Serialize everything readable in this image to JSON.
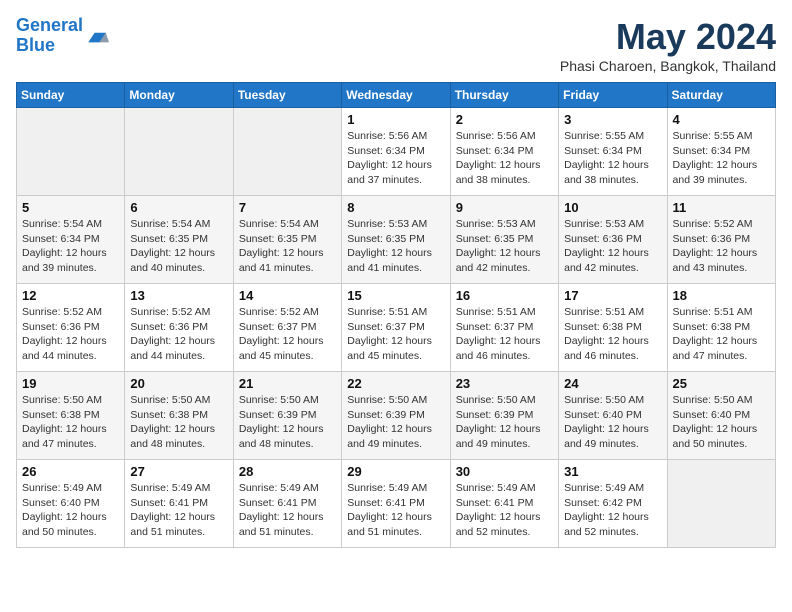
{
  "header": {
    "logo_line1": "General",
    "logo_line2": "Blue",
    "month": "May 2024",
    "location": "Phasi Charoen, Bangkok, Thailand"
  },
  "weekdays": [
    "Sunday",
    "Monday",
    "Tuesday",
    "Wednesday",
    "Thursday",
    "Friday",
    "Saturday"
  ],
  "weeks": [
    [
      {
        "day": "",
        "info": ""
      },
      {
        "day": "",
        "info": ""
      },
      {
        "day": "",
        "info": ""
      },
      {
        "day": "1",
        "info": "Sunrise: 5:56 AM\nSunset: 6:34 PM\nDaylight: 12 hours\nand 37 minutes."
      },
      {
        "day": "2",
        "info": "Sunrise: 5:56 AM\nSunset: 6:34 PM\nDaylight: 12 hours\nand 38 minutes."
      },
      {
        "day": "3",
        "info": "Sunrise: 5:55 AM\nSunset: 6:34 PM\nDaylight: 12 hours\nand 38 minutes."
      },
      {
        "day": "4",
        "info": "Sunrise: 5:55 AM\nSunset: 6:34 PM\nDaylight: 12 hours\nand 39 minutes."
      }
    ],
    [
      {
        "day": "5",
        "info": "Sunrise: 5:54 AM\nSunset: 6:34 PM\nDaylight: 12 hours\nand 39 minutes."
      },
      {
        "day": "6",
        "info": "Sunrise: 5:54 AM\nSunset: 6:35 PM\nDaylight: 12 hours\nand 40 minutes."
      },
      {
        "day": "7",
        "info": "Sunrise: 5:54 AM\nSunset: 6:35 PM\nDaylight: 12 hours\nand 41 minutes."
      },
      {
        "day": "8",
        "info": "Sunrise: 5:53 AM\nSunset: 6:35 PM\nDaylight: 12 hours\nand 41 minutes."
      },
      {
        "day": "9",
        "info": "Sunrise: 5:53 AM\nSunset: 6:35 PM\nDaylight: 12 hours\nand 42 minutes."
      },
      {
        "day": "10",
        "info": "Sunrise: 5:53 AM\nSunset: 6:36 PM\nDaylight: 12 hours\nand 42 minutes."
      },
      {
        "day": "11",
        "info": "Sunrise: 5:52 AM\nSunset: 6:36 PM\nDaylight: 12 hours\nand 43 minutes."
      }
    ],
    [
      {
        "day": "12",
        "info": "Sunrise: 5:52 AM\nSunset: 6:36 PM\nDaylight: 12 hours\nand 44 minutes."
      },
      {
        "day": "13",
        "info": "Sunrise: 5:52 AM\nSunset: 6:36 PM\nDaylight: 12 hours\nand 44 minutes."
      },
      {
        "day": "14",
        "info": "Sunrise: 5:52 AM\nSunset: 6:37 PM\nDaylight: 12 hours\nand 45 minutes."
      },
      {
        "day": "15",
        "info": "Sunrise: 5:51 AM\nSunset: 6:37 PM\nDaylight: 12 hours\nand 45 minutes."
      },
      {
        "day": "16",
        "info": "Sunrise: 5:51 AM\nSunset: 6:37 PM\nDaylight: 12 hours\nand 46 minutes."
      },
      {
        "day": "17",
        "info": "Sunrise: 5:51 AM\nSunset: 6:38 PM\nDaylight: 12 hours\nand 46 minutes."
      },
      {
        "day": "18",
        "info": "Sunrise: 5:51 AM\nSunset: 6:38 PM\nDaylight: 12 hours\nand 47 minutes."
      }
    ],
    [
      {
        "day": "19",
        "info": "Sunrise: 5:50 AM\nSunset: 6:38 PM\nDaylight: 12 hours\nand 47 minutes."
      },
      {
        "day": "20",
        "info": "Sunrise: 5:50 AM\nSunset: 6:38 PM\nDaylight: 12 hours\nand 48 minutes."
      },
      {
        "day": "21",
        "info": "Sunrise: 5:50 AM\nSunset: 6:39 PM\nDaylight: 12 hours\nand 48 minutes."
      },
      {
        "day": "22",
        "info": "Sunrise: 5:50 AM\nSunset: 6:39 PM\nDaylight: 12 hours\nand 49 minutes."
      },
      {
        "day": "23",
        "info": "Sunrise: 5:50 AM\nSunset: 6:39 PM\nDaylight: 12 hours\nand 49 minutes."
      },
      {
        "day": "24",
        "info": "Sunrise: 5:50 AM\nSunset: 6:40 PM\nDaylight: 12 hours\nand 49 minutes."
      },
      {
        "day": "25",
        "info": "Sunrise: 5:50 AM\nSunset: 6:40 PM\nDaylight: 12 hours\nand 50 minutes."
      }
    ],
    [
      {
        "day": "26",
        "info": "Sunrise: 5:49 AM\nSunset: 6:40 PM\nDaylight: 12 hours\nand 50 minutes."
      },
      {
        "day": "27",
        "info": "Sunrise: 5:49 AM\nSunset: 6:41 PM\nDaylight: 12 hours\nand 51 minutes."
      },
      {
        "day": "28",
        "info": "Sunrise: 5:49 AM\nSunset: 6:41 PM\nDaylight: 12 hours\nand 51 minutes."
      },
      {
        "day": "29",
        "info": "Sunrise: 5:49 AM\nSunset: 6:41 PM\nDaylight: 12 hours\nand 51 minutes."
      },
      {
        "day": "30",
        "info": "Sunrise: 5:49 AM\nSunset: 6:41 PM\nDaylight: 12 hours\nand 52 minutes."
      },
      {
        "day": "31",
        "info": "Sunrise: 5:49 AM\nSunset: 6:42 PM\nDaylight: 12 hours\nand 52 minutes."
      },
      {
        "day": "",
        "info": ""
      }
    ]
  ]
}
